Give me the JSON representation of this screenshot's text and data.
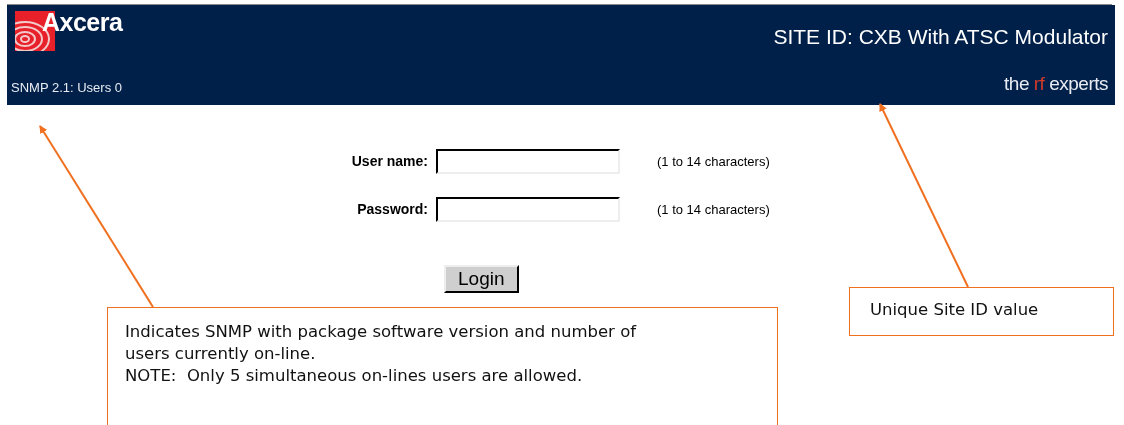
{
  "header": {
    "logo_text": "Axcera",
    "site_id": "SITE ID: CXB With ATSC Modulator",
    "status": "SNMP 2.1: Users 0",
    "tagline": [
      {
        "text": "the",
        "accent": false
      },
      {
        "text": "rf",
        "accent": true
      },
      {
        "text": "experts",
        "accent": false
      }
    ]
  },
  "form": {
    "fields": [
      {
        "label": "User name:",
        "hint": "(1 to 14 characters)"
      },
      {
        "label": "Password:",
        "hint": "(1 to 14 characters)"
      }
    ],
    "button": "Login"
  },
  "callouts": [
    {
      "kind": "status",
      "paragraphs": [
        "Indicates SNMP with package software version and number of users currently on-line.",
        "NOTE:  Only 5 simultaneous on-lines users are allowed."
      ]
    },
    {
      "kind": "site_id",
      "paragraphs": [
        "Unique Site ID value"
      ]
    }
  ]
}
